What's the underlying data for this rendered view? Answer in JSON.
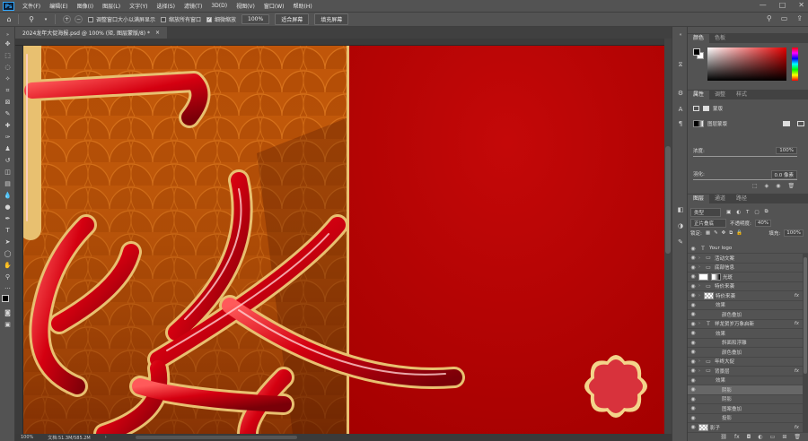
{
  "menu": {
    "app_icon": "Ps",
    "items": [
      "文件(F)",
      "编辑(E)",
      "图像(I)",
      "图层(L)",
      "文字(Y)",
      "选择(S)",
      "滤镜(T)",
      "3D(D)",
      "视图(V)",
      "窗口(W)",
      "帮助(H)"
    ]
  },
  "window_controls": [
    "—",
    "□",
    "✕"
  ],
  "options_bar": {
    "tool_icon": "zoom-icon",
    "check1": "调整窗口大小以满屏显示",
    "check2": "缩放所有窗口",
    "check3": "细微缩放",
    "check3_checked": true,
    "zoom_value": "100%",
    "fit_button": "适合屏幕",
    "fill_button": "填充屏幕"
  },
  "document_tab": {
    "title": "2024龙年大促海报.psd @ 100% (矩, 图层蒙版/8) *",
    "close": "×"
  },
  "status_bar": {
    "zoom": "100%",
    "doc_info": "文档:51.3M/585.2M",
    "arrow": "›"
  },
  "color_panel": {
    "tabs": [
      "颜色",
      "色板"
    ],
    "active_tab": 0,
    "hue_color": "#e30000"
  },
  "properties_panel": {
    "tabs": [
      "属性",
      "调整",
      "样式"
    ],
    "active_tab": 0,
    "mask_label": "蒙版",
    "layer_mask_label": "图层蒙版",
    "density_label": "浓度:",
    "density_value": "100%",
    "feather_label": "羽化:",
    "feather_value": "0.0 像素"
  },
  "layers_panel": {
    "tabs": [
      "图层",
      "通道",
      "路径"
    ],
    "active_tab": 0,
    "filter_kind": "类型",
    "blend_mode": "正片叠底",
    "opacity_label": "不透明度:",
    "opacity_value": "40%",
    "lock_label": "锁定:",
    "fill_label": "填充:",
    "fill_value": "100%",
    "layers": [
      {
        "name": "Your logo",
        "type": "text",
        "indent": 0,
        "fx": false,
        "arrow": false
      },
      {
        "name": "活动文案",
        "type": "folder",
        "indent": 0,
        "fx": false,
        "arrow": true
      },
      {
        "name": "底部信息",
        "type": "folder",
        "indent": 0,
        "fx": false,
        "arrow": true
      },
      {
        "name": "光斑",
        "type": "masked",
        "indent": 0,
        "fx": false,
        "arrow": false
      },
      {
        "name": "特价来袭",
        "type": "folder",
        "indent": 0,
        "fx": false,
        "arrow": true
      },
      {
        "name": "特价来袭",
        "type": "checker",
        "indent": 0,
        "fx": true,
        "arrow": true
      },
      {
        "name": "效果",
        "type": "effect-head",
        "indent": 1,
        "fx": false,
        "arrow": false
      },
      {
        "name": "颜色叠加",
        "type": "effect",
        "indent": 2,
        "fx": false,
        "arrow": false
      },
      {
        "name": "祥龙贺岁万象启新",
        "type": "text",
        "indent": 0,
        "fx": true,
        "arrow": true
      },
      {
        "name": "效果",
        "type": "effect-head",
        "indent": 1,
        "fx": false,
        "arrow": false
      },
      {
        "name": "斜面和浮雕",
        "type": "effect",
        "indent": 2,
        "fx": false,
        "arrow": false
      },
      {
        "name": "颜色叠加",
        "type": "effect",
        "indent": 2,
        "fx": false,
        "arrow": false
      },
      {
        "name": "年终大促",
        "type": "folder",
        "indent": 0,
        "fx": false,
        "arrow": true
      },
      {
        "name": "背景层",
        "type": "folder",
        "indent": 0,
        "fx": true,
        "arrow": true
      },
      {
        "name": "效果",
        "type": "effect-head",
        "indent": 1,
        "fx": false,
        "arrow": false
      },
      {
        "name": "阴影",
        "type": "effect",
        "indent": 2,
        "fx": false,
        "arrow": false
      },
      {
        "name": "阴影",
        "type": "effect",
        "indent": 2,
        "fx": false,
        "arrow": false
      },
      {
        "name": "图案叠加",
        "type": "effect",
        "indent": 2,
        "fx": false,
        "arrow": false
      },
      {
        "name": "投影",
        "type": "effect",
        "indent": 2,
        "fx": false,
        "arrow": false
      },
      {
        "name": "影子",
        "type": "checker",
        "indent": 0,
        "fx": true,
        "arrow": false
      }
    ],
    "footer_icons": [
      "link-icon",
      "fx-icon",
      "mask-icon",
      "adjustment-icon",
      "group-icon",
      "new-layer-icon",
      "trash-icon"
    ]
  }
}
